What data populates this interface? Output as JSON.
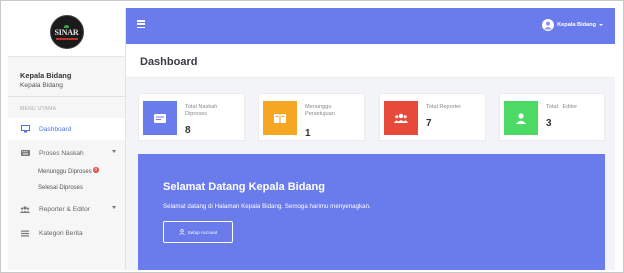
{
  "sidebar": {
    "logo_text": "SINAR",
    "user_name": "Kepala Bidang",
    "user_role": "Kepala Bidang",
    "menu_heading": "MENU UTAMA",
    "items": [
      {
        "label": "Dashboard",
        "icon": "monitor-icon"
      },
      {
        "label": "Proses Naskah",
        "icon": "keyboard-icon"
      },
      {
        "label": "Reporter & Editor",
        "icon": "users-icon"
      },
      {
        "label": "Kategori Berita",
        "icon": "list-icon"
      }
    ],
    "sub_items": [
      {
        "label": "Menunggu Diproses",
        "badge": "0"
      },
      {
        "label": "Selesai Diproses"
      }
    ]
  },
  "topbar": {
    "profile_name": "Kepala Bidang"
  },
  "page": {
    "title": "Dashboard"
  },
  "cards": [
    {
      "label": "Total Naskah Diproses",
      "value": "8",
      "color": "#6a7bec",
      "icon": "document-icon"
    },
    {
      "label": "Menunggu Persetujuan",
      "value": "1",
      "color": "#f5a623",
      "icon": "book-icon"
    },
    {
      "label": "Total Reporter",
      "value": "7",
      "color": "#e74a3b",
      "icon": "users-icon"
    },
    {
      "label": "Total   Editor",
      "value": "3",
      "color": "#4cd964",
      "icon": "user-icon"
    }
  ],
  "welcome": {
    "title": "Selamat Datang Kepala Bidang",
    "text": "Selamat datang di Halaman Kepala Bidang. Semoga harimu menyenagkan.",
    "button_label": "Setup Account"
  },
  "colors": {
    "primary": "#6a7bec",
    "active_nav": "#4e73df"
  }
}
